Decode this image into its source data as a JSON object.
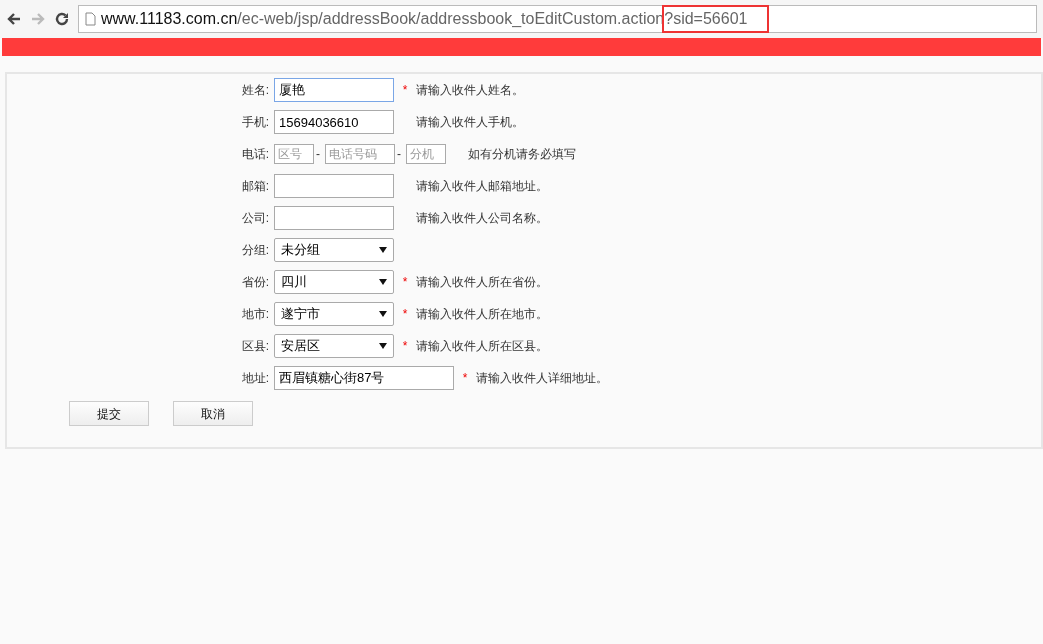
{
  "browser": {
    "url_host": "www.11183.com.cn",
    "url_path": "/ec-web/jsp/addressBook/addressbook_toEditCustom.action",
    "url_query": "?sid=56601",
    "query_highlighted": true
  },
  "form": {
    "rows": [
      {
        "kind": "text",
        "label": "姓名:",
        "value": "厦艳",
        "focused": true,
        "required": true,
        "hint": "请输入收件人姓名。"
      },
      {
        "kind": "text",
        "label": "手机:",
        "value": "15694036610",
        "focused": false,
        "required": false,
        "hint": "请输入收件人手机。"
      },
      {
        "kind": "phone",
        "label": "电话:",
        "parts": [
          {
            "placeholder": "区号"
          },
          {
            "placeholder": "电话号码"
          },
          {
            "placeholder": "分机"
          }
        ],
        "separators": [
          "-",
          "-"
        ],
        "required": false,
        "hint": "如有分机请务必填写"
      },
      {
        "kind": "text",
        "label": "邮箱:",
        "value": "",
        "focused": false,
        "required": false,
        "hint": "请输入收件人邮箱地址。"
      },
      {
        "kind": "text",
        "label": "公司:",
        "value": "",
        "focused": false,
        "required": false,
        "hint": "请输入收件人公司名称。"
      },
      {
        "kind": "select",
        "label": "分组:",
        "value": "未分组",
        "required": false
      },
      {
        "kind": "select",
        "label": "省份:",
        "value": "四川",
        "required": true,
        "hint": "请输入收件人所在省份。"
      },
      {
        "kind": "select",
        "label": "地市:",
        "value": "遂宁市",
        "required": true,
        "hint": "请输入收件人所在地市。"
      },
      {
        "kind": "select",
        "label": "区县:",
        "value": "安居区",
        "required": true,
        "hint": "请输入收件人所在区县。"
      },
      {
        "kind": "wide",
        "label": "地址:",
        "value": "西眉镇糖心街87号",
        "focused": false,
        "required": true,
        "hint": "请输入收件人详细地址。"
      }
    ],
    "required_mark": "*",
    "buttons": [
      "提交",
      "取消"
    ]
  }
}
